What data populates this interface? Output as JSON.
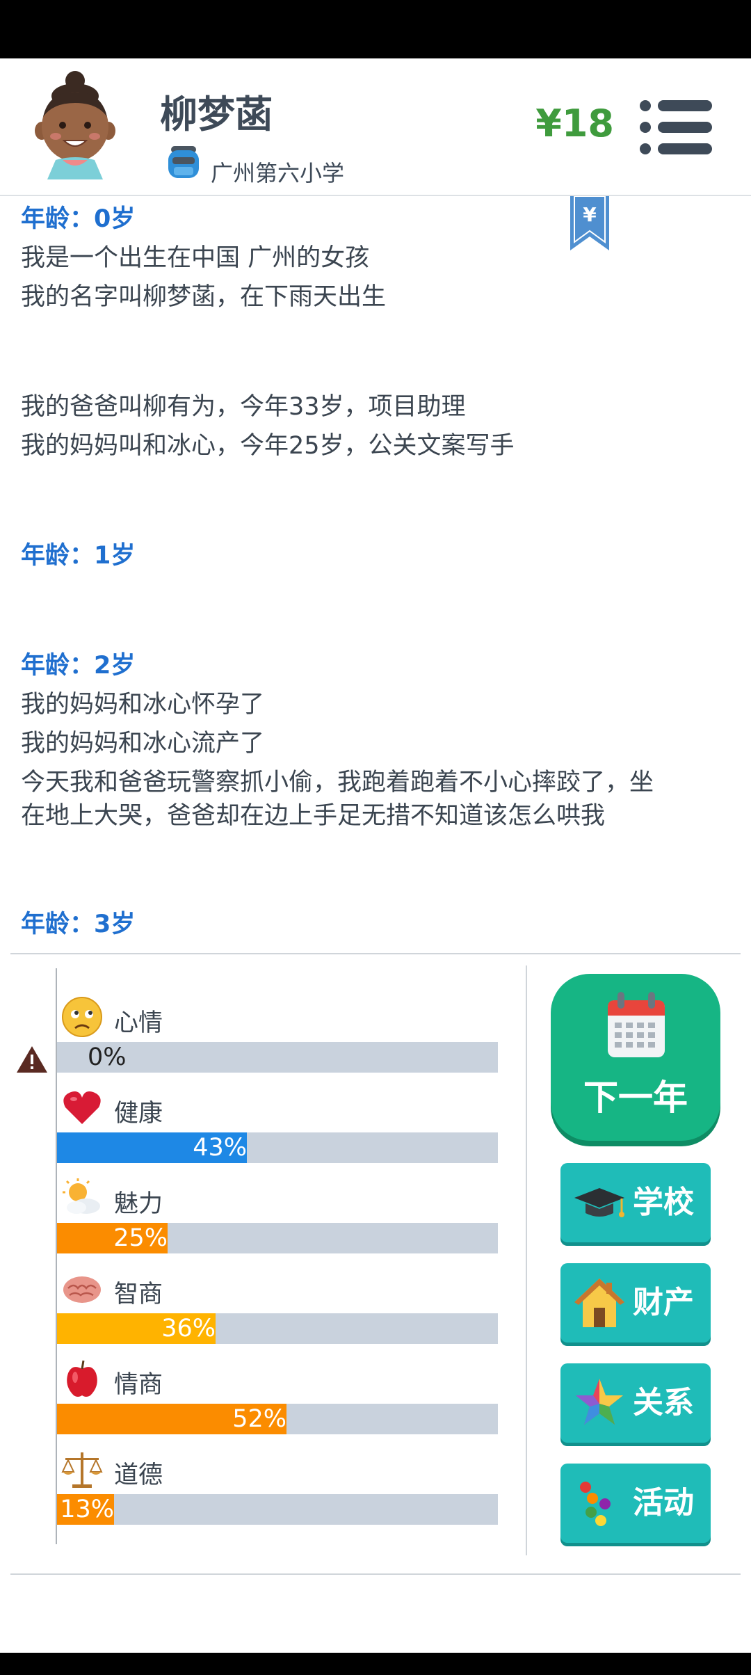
{
  "header": {
    "name": "柳梦菡",
    "school": "广州第六小学",
    "money": "¥18"
  },
  "ribbon": {
    "symbol": "¥"
  },
  "log": [
    {
      "text": "年龄：0岁",
      "kind": "age"
    },
    {
      "text": "我是一个出生在中国 广州的女孩",
      "kind": "line"
    },
    {
      "text": "我的名字叫柳梦菡，在下雨天出生",
      "kind": "line"
    },
    {
      "text": "我的爸爸叫柳有为，今年33岁，项目助理",
      "kind": "line"
    },
    {
      "text": "我的妈妈叫和冰心，今年25岁，公关文案写手",
      "kind": "line"
    },
    {
      "text": "年龄：1岁",
      "kind": "age"
    },
    {
      "text": "年龄：2岁",
      "kind": "age"
    },
    {
      "text": "我的妈妈和冰心怀孕了",
      "kind": "line"
    },
    {
      "text": "我的妈妈和冰心流产了",
      "kind": "line"
    },
    {
      "text": "今天我和爸爸玩警察抓小偷，我跑着跑着不小心摔跤了，坐",
      "kind": "line"
    },
    {
      "text": "在地上大哭，爸爸却在边上手足无措不知道该怎么哄我",
      "kind": "line"
    },
    {
      "text": "年龄：3岁",
      "kind": "age"
    }
  ],
  "stats": [
    {
      "label": "心情",
      "value": 0,
      "text": "0%",
      "color": "#c9d2dd",
      "icon": "sad-face-icon"
    },
    {
      "label": "健康",
      "value": 43,
      "text": "43%",
      "color": "#1e88e5",
      "icon": "heart-icon"
    },
    {
      "label": "魅力",
      "value": 25,
      "text": "25%",
      "color": "#fb8c00",
      "icon": "sun-cloud-icon"
    },
    {
      "label": "智商",
      "value": 36,
      "text": "36%",
      "color": "#ffb300",
      "icon": "brain-icon"
    },
    {
      "label": "情商",
      "value": 52,
      "text": "52%",
      "color": "#fb8c00",
      "icon": "apple-icon"
    },
    {
      "label": "道德",
      "value": 13,
      "text": "13%",
      "color": "#fb8c00",
      "icon": "scales-icon"
    }
  ],
  "buttons": {
    "next_year": "下一年",
    "school": "学校",
    "assets": "财产",
    "relations": "关系",
    "activities": "活动"
  },
  "colors": {
    "age_heading": "#1f6fcf",
    "money": "#3f9b3d",
    "next_year_button": "#16b584",
    "side_button": "#1fbcb8"
  }
}
